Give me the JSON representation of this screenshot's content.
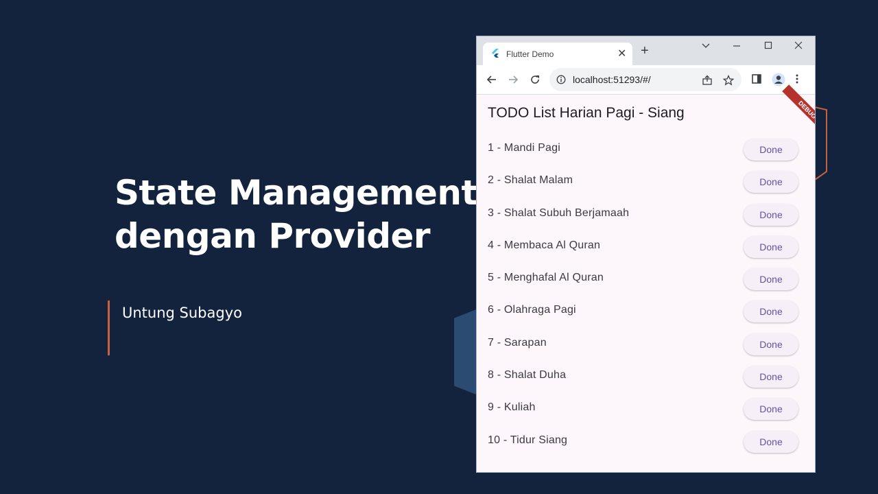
{
  "slide": {
    "title_line1": "State Management",
    "title_line2": "dengan Provider",
    "author": "Untung Subagyo"
  },
  "colors": {
    "background": "#13233d",
    "accent": "#c8623e",
    "primary": "#6750a4",
    "debug_banner": "#b4332d"
  },
  "browser": {
    "tab": {
      "title": "Flutter Demo",
      "icon": "flutter-logo-icon",
      "close_icon": "close-icon"
    },
    "new_tab_icon": "plus-icon",
    "window_controls": [
      "chevron-down-icon",
      "minimize-icon",
      "maximize-icon",
      "close-icon"
    ],
    "address_bar": {
      "url": "localhost:51293/#/"
    },
    "toolbar_icons": [
      "back-arrow-icon",
      "forward-arrow-icon",
      "reload-icon",
      "info-icon",
      "share-icon",
      "star-icon",
      "side-panel-icon",
      "profile-icon",
      "more-vert-icon"
    ]
  },
  "app": {
    "title": "TODO List Harian Pagi - Siang",
    "debug_label": "DEBUG",
    "items": [
      {
        "label": "1 - Mandi Pagi",
        "button": "Done"
      },
      {
        "label": "2 - Shalat Malam",
        "button": "Done"
      },
      {
        "label": "3 - Shalat Subuh Berjamaah",
        "button": "Done"
      },
      {
        "label": "4 - Membaca Al Quran",
        "button": "Done"
      },
      {
        "label": "5 - Menghafal Al Quran",
        "button": "Done"
      },
      {
        "label": "6 - Olahraga Pagi",
        "button": "Done"
      },
      {
        "label": "7 - Sarapan",
        "button": "Done"
      },
      {
        "label": "8 - Shalat Duha",
        "button": "Done"
      },
      {
        "label": "9 - Kuliah",
        "button": "Done"
      },
      {
        "label": "10 - Tidur Siang",
        "button": "Done"
      }
    ]
  }
}
